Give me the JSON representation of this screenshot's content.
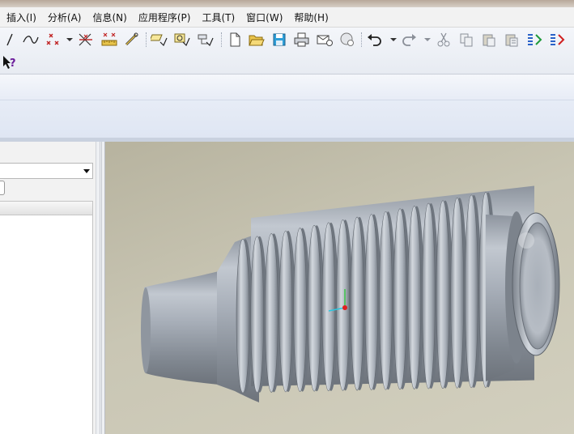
{
  "menubar": {
    "items": [
      {
        "label": "插入(I)"
      },
      {
        "label": "分析(A)"
      },
      {
        "label": "信息(N)"
      },
      {
        "label": "应用程序(P)"
      },
      {
        "label": "工具(T)"
      },
      {
        "label": "窗口(W)"
      },
      {
        "label": "帮助(H)"
      }
    ]
  },
  "toolbar": {
    "row1_icons": [
      "line-icon",
      "spline-icon",
      "point-icon",
      "dropdown-icon",
      "axis-icon",
      "measure-icon",
      "chain-icon",
      "datum-plane-icon",
      "datum-axis-icon",
      "datum-csys-icon",
      "new-file-icon",
      "open-folder-icon",
      "save-icon",
      "print-icon",
      "send-mail-icon",
      "erase-icon",
      "undo-icon",
      "redo-icon",
      "cut-icon",
      "copy-icon",
      "paste-icon",
      "paste-special-icon",
      "regenerate-icon",
      "regenerate-manager-icon"
    ],
    "row2_icons": [
      "context-help-icon"
    ],
    "help_glyph": "?"
  },
  "colors": {
    "menu_bg": "#f2f2f2",
    "toolbar_bg": "#eef1f6",
    "viewport_bg": "#c4c1ae",
    "model_gray": "#a2a9b3",
    "axis_green": "#3cc64a",
    "axis_red": "#e02020",
    "axis_cyan": "#29c8e0"
  },
  "viewport": {
    "model": "bellows-tube"
  }
}
